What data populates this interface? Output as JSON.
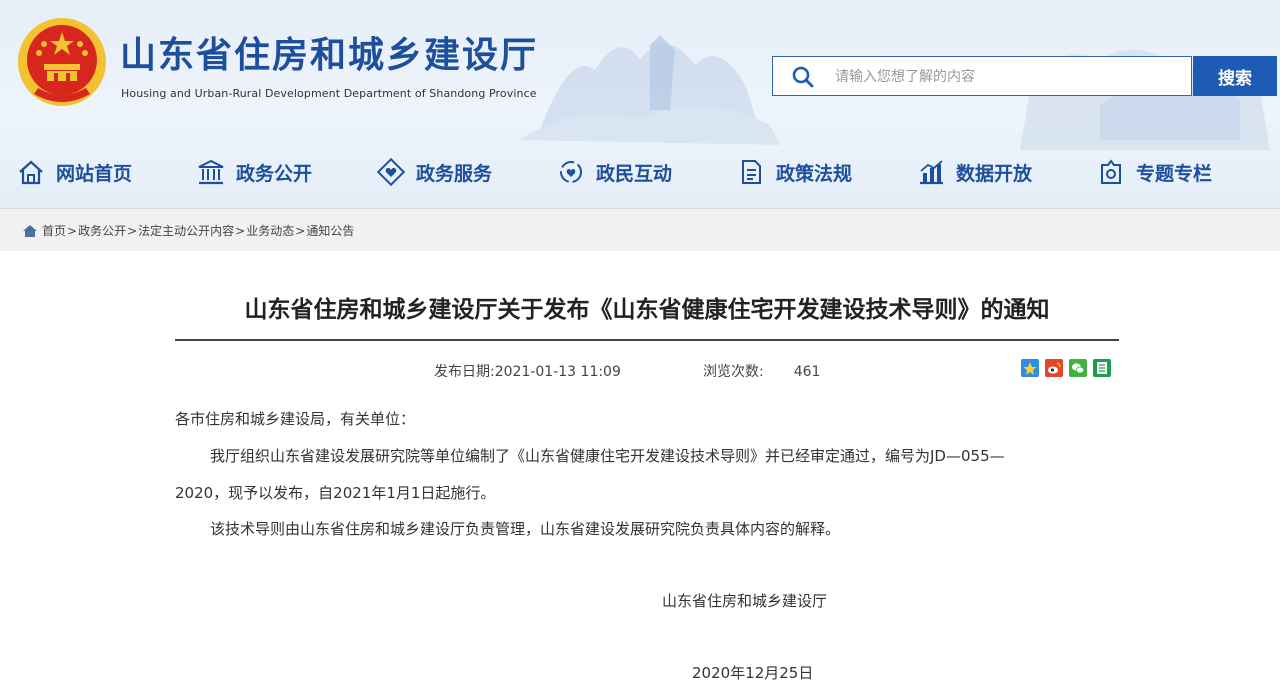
{
  "header": {
    "site_title": "山东省住房和城乡建设厅",
    "site_subtitle": "Housing and Urban-Rural Development Department of Shandong Province",
    "search": {
      "placeholder": "请输入您想了解的内容",
      "button_label": "搜索"
    }
  },
  "nav": {
    "items": [
      {
        "label": "网站首页",
        "icon": "home-icon"
      },
      {
        "label": "政务公开",
        "icon": "government-building-icon"
      },
      {
        "label": "政务服务",
        "icon": "heart-diamond-icon"
      },
      {
        "label": "政民互动",
        "icon": "interaction-icon"
      },
      {
        "label": "政策法规",
        "icon": "document-icon"
      },
      {
        "label": "数据开放",
        "icon": "bar-chart-icon"
      },
      {
        "label": "专题专栏",
        "icon": "topic-icon"
      }
    ]
  },
  "breadcrumb": {
    "items": [
      "首页",
      "政务公开",
      "法定主动公开内容",
      "业务动态",
      "通知公告"
    ],
    "separator": ">"
  },
  "article": {
    "title": "山东省住房和城乡建设厅关于发布《山东省健康住宅开发建设技术导则》的通知",
    "publish_label": "发布日期:",
    "publish_date": "2021-01-13 11:09",
    "views_label": "浏览次数:",
    "views_count": "461",
    "share_icons": [
      "qzone-icon",
      "weibo-icon",
      "wechat-icon",
      "print-icon"
    ],
    "salutation": "各市住房和城乡建设局，有关单位：",
    "para1_line1": "我厅组织山东省建设发展研究院等单位编制了《山东省健康住宅开发建设技术导则》并已经审定通过，编号为JD—055—",
    "para1_line2": "2020，现予以发布，自2021年1月1日起施行。",
    "para2": "该技术导则由山东省住房和城乡建设厅负责管理，山东省建设发展研究院负责具体内容的解释。",
    "signature": "山东省住房和城乡建设厅",
    "date": "2020年12月25日"
  },
  "colors": {
    "brand_blue": "#1d4f9c",
    "button_blue": "#1e5bb5",
    "emblem_red": "#d7261e",
    "emblem_gold": "#f2c230"
  }
}
